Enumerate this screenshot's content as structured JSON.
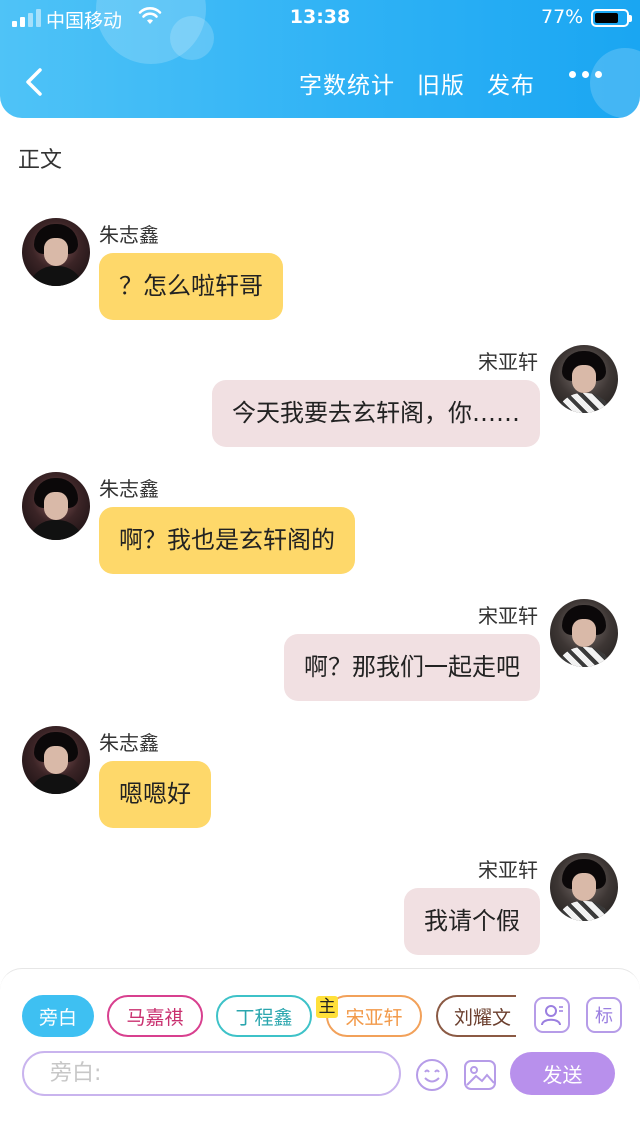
{
  "status_bar": {
    "carrier": "中国移动",
    "time": "13:38",
    "battery": "77%",
    "battery_level": 0.77
  },
  "header": {
    "back_icon": "chevron-left-icon",
    "actions": [
      "字数统计",
      "旧版",
      "发布"
    ],
    "more_icon": "more-dots-icon"
  },
  "section_title": "正文",
  "messages": [
    {
      "side": "left",
      "sender": "朱志鑫",
      "text": "？怎么啦轩哥"
    },
    {
      "side": "right",
      "sender": "宋亚轩",
      "text": "今天我要去玄轩阁，你……"
    },
    {
      "side": "left",
      "sender": "朱志鑫",
      "text": "啊？我也是玄轩阁的"
    },
    {
      "side": "right",
      "sender": "宋亚轩",
      "text": "啊？那我们一起走吧"
    },
    {
      "side": "left",
      "sender": "朱志鑫",
      "text": "嗯嗯好"
    },
    {
      "side": "right",
      "sender": "宋亚轩",
      "text": "我请个假"
    }
  ],
  "composer": {
    "roles": [
      {
        "label": "旁白",
        "selected": true
      },
      {
        "label": "马嘉祺"
      },
      {
        "label": "丁程鑫"
      },
      {
        "label": "宋亚轩"
      },
      {
        "label": "刘耀文"
      }
    ],
    "main_tag": "主",
    "add_role_icon": "person-add-icon",
    "tag_button": "标",
    "input_placeholder": "旁白:",
    "emoji_icon": "emoji-icon",
    "image_icon": "image-icon",
    "send_label": "发送"
  },
  "colors": {
    "header": "#2fb2f5",
    "left_bubble": "#fed86a",
    "right_bubble": "#f1e0e2",
    "send_button": "#b890ec"
  }
}
